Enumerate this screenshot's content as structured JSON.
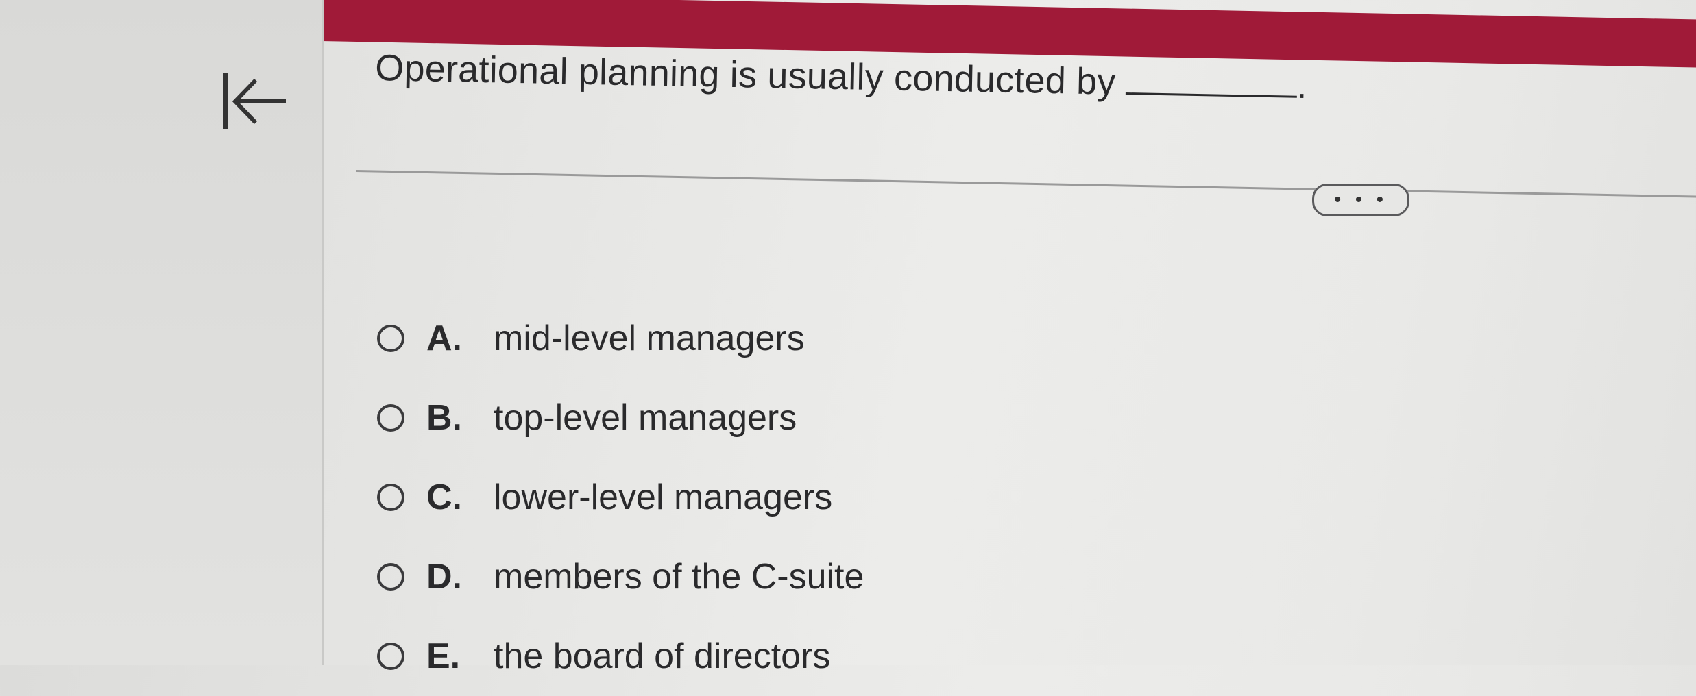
{
  "question": {
    "prefix": "Operational planning is usually conducted by",
    "suffix": "."
  },
  "more_button_label": "• • •",
  "options": [
    {
      "letter": "A.",
      "text": "mid-level managers"
    },
    {
      "letter": "B.",
      "text": "top-level managers"
    },
    {
      "letter": "C.",
      "text": "lower-level managers"
    },
    {
      "letter": "D.",
      "text": "members of the C-suite"
    },
    {
      "letter": "E.",
      "text": "the board of directors"
    }
  ]
}
